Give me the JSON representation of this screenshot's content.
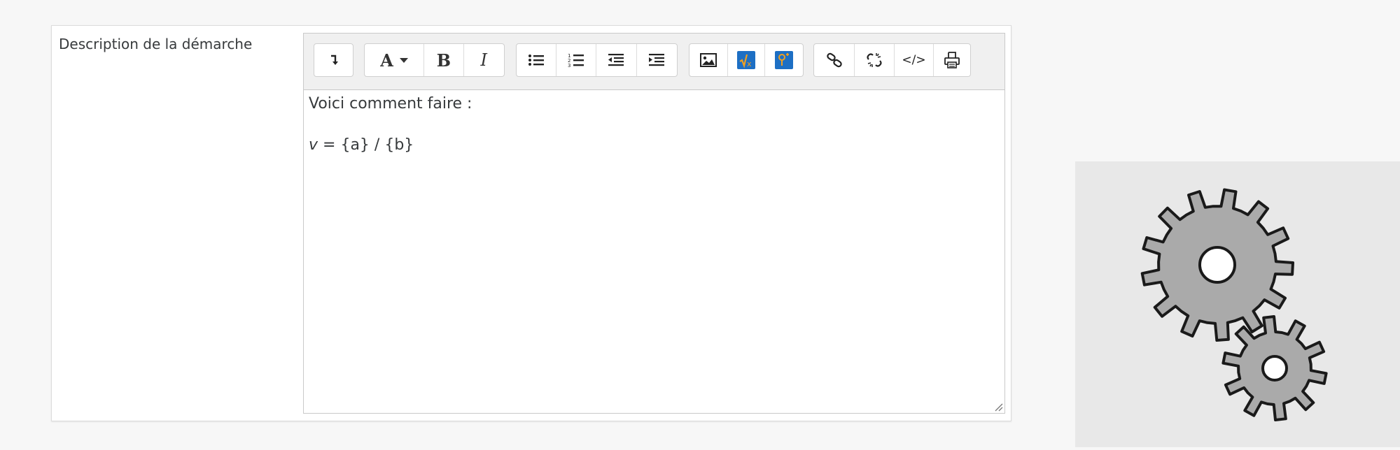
{
  "form": {
    "field_label": "Description de la démarche"
  },
  "toolbar": {
    "groups": [
      [
        {
          "icon": "collapse-icon"
        }
      ],
      [
        {
          "icon": "font-style-icon",
          "label": "A"
        },
        {
          "icon": "bold-icon",
          "label": "B"
        },
        {
          "icon": "italic-icon",
          "label": "I"
        }
      ],
      [
        {
          "icon": "unordered-list-icon"
        },
        {
          "icon": "ordered-list-icon"
        },
        {
          "icon": "outdent-icon"
        },
        {
          "icon": "indent-icon"
        }
      ],
      [
        {
          "icon": "image-icon"
        },
        {
          "icon": "equation-icon"
        },
        {
          "icon": "wiris-chem-icon"
        }
      ],
      [
        {
          "icon": "link-icon"
        },
        {
          "icon": "unlink-icon"
        },
        {
          "icon": "html-icon",
          "label": "</>"
        },
        {
          "icon": "print-icon"
        }
      ]
    ],
    "font_label": "A",
    "bold_label": "B",
    "italic_label": "I",
    "html_label": "</>"
  },
  "editor": {
    "line1": "Voici comment faire :",
    "line2_var": "v",
    "line2_rest": " = {a} / {b}"
  },
  "colors": {
    "accent_blue": "#1d6fc4",
    "accent_orange": "#f0a020",
    "gear_fill": "#aaaaaa",
    "gear_stroke": "#1a1a1a"
  }
}
